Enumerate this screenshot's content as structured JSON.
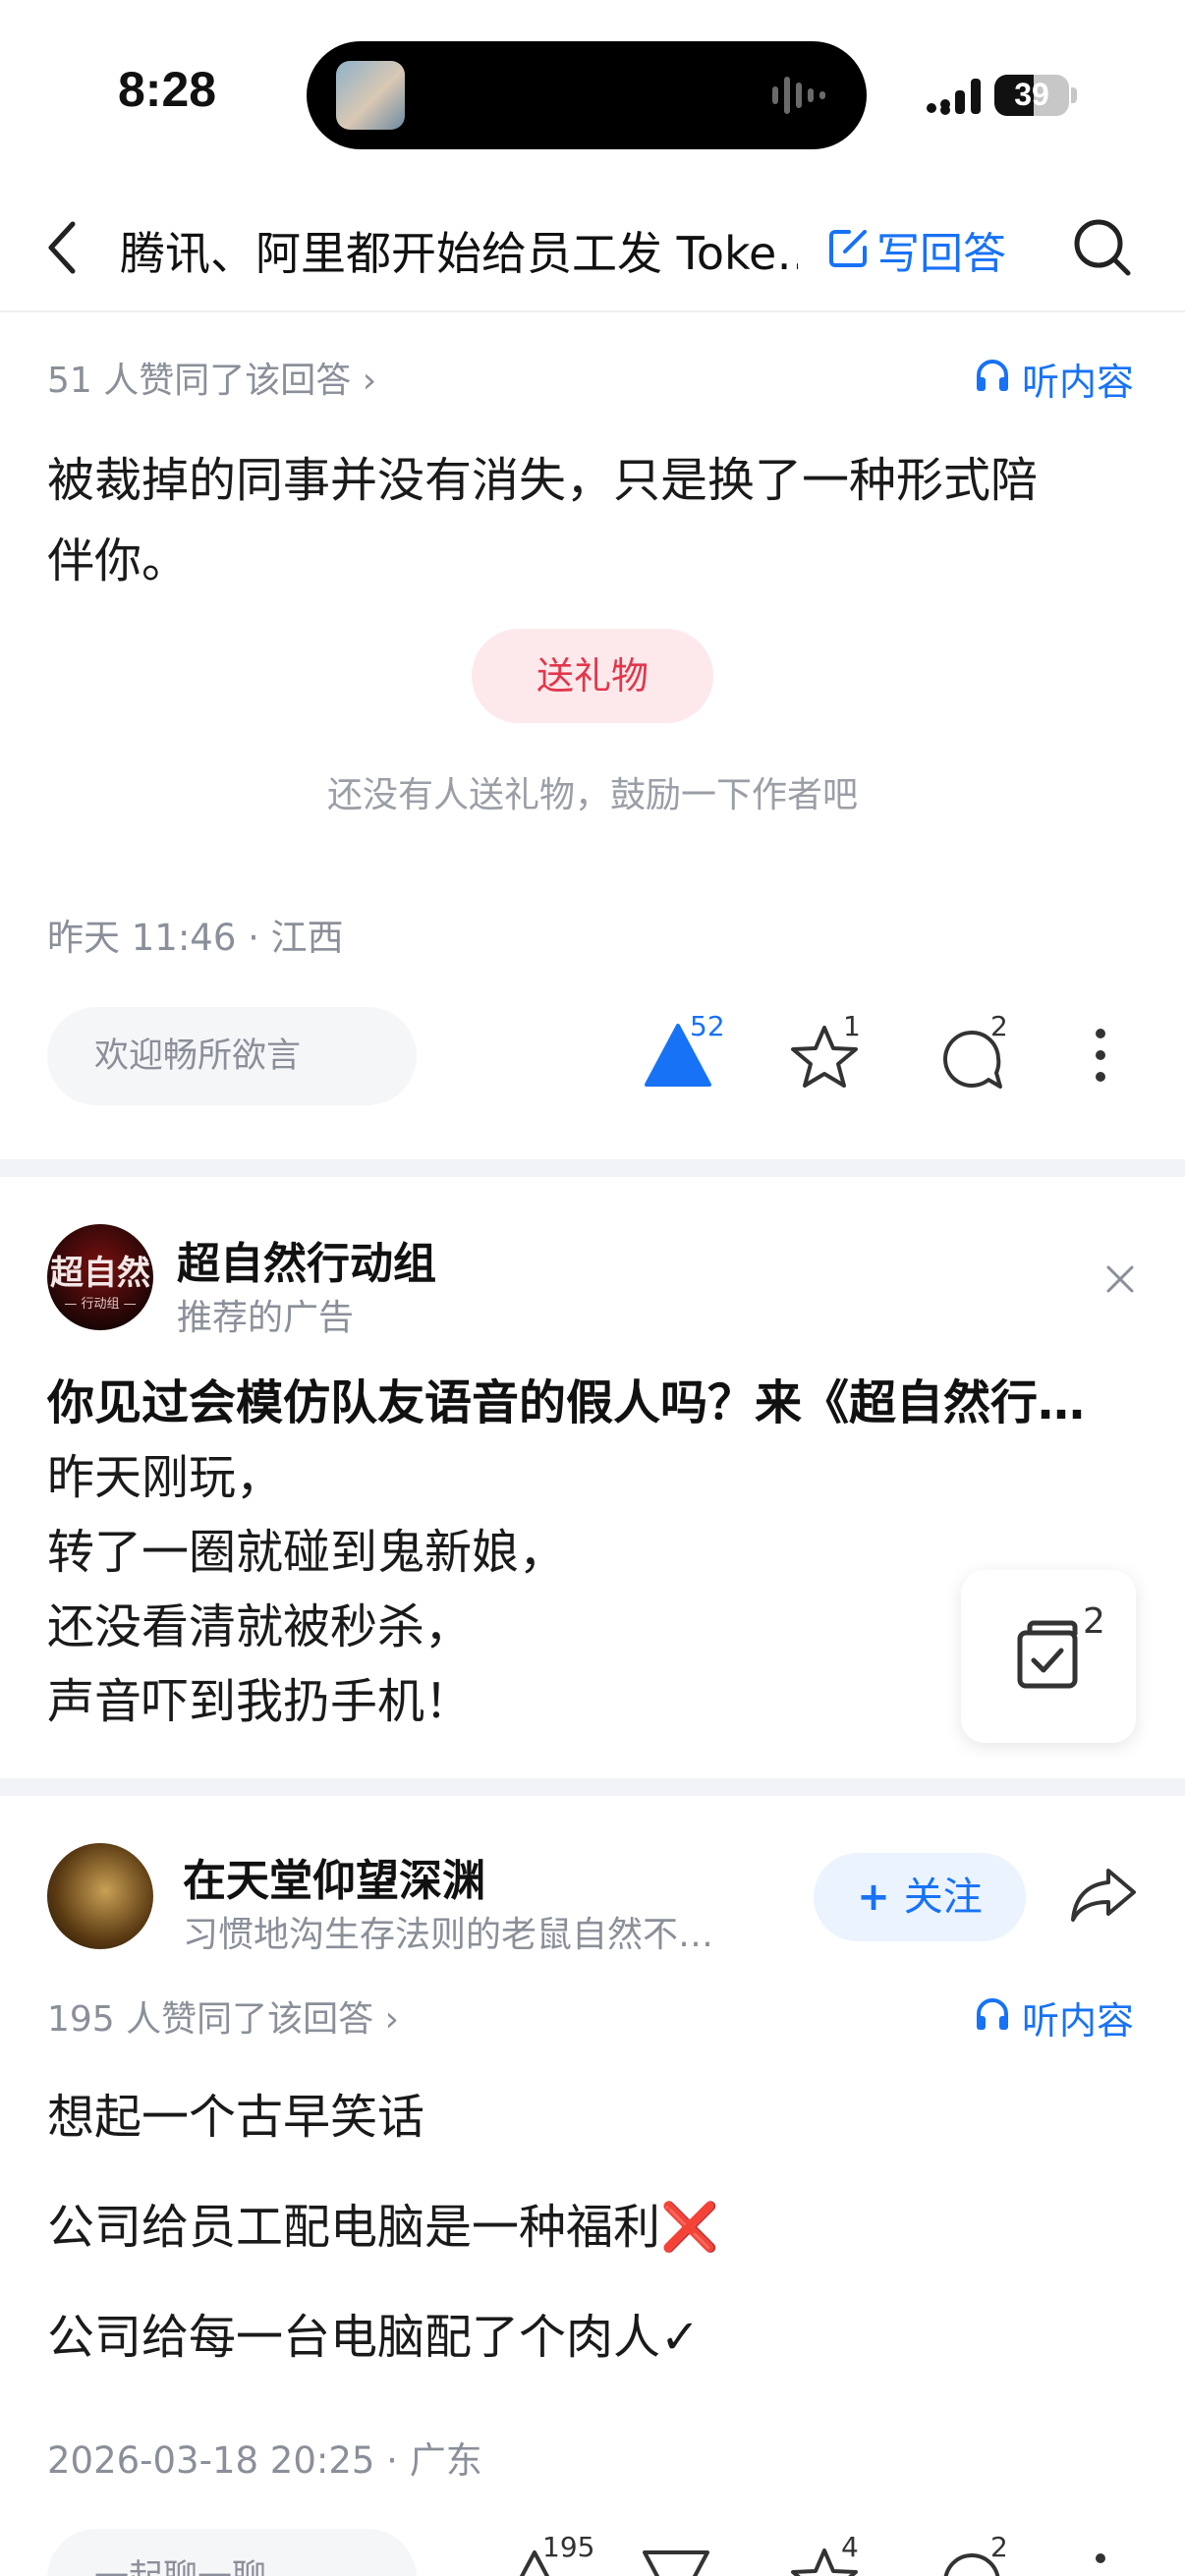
{
  "status_bar": {
    "time": "8:28",
    "battery": "39"
  },
  "nav": {
    "title": "腾讯、阿里都开始给员工发 Toke…",
    "write_label": "写回答"
  },
  "answer1": {
    "likes_text": "51 人赞同了该回答 ›",
    "listen_label": "听内容",
    "lines": [
      "被裁掉的同事并没有消失，只是换了一种形式陪",
      "伴你。"
    ],
    "gift_label": "送礼物",
    "gift_hint": "还没有人送礼物，鼓励一下作者吧",
    "meta": "昨天 11:46 · 江西",
    "comment_placeholder": "欢迎畅所欲言",
    "upvotes": "52",
    "favorites": "1",
    "comments": "2"
  },
  "ad": {
    "avatar_text": "超自然",
    "avatar_sub": "— 行动组 —",
    "name": "超自然行动组",
    "label": "推荐的广告",
    "title": "你见过会模仿队友语音的假人吗？来《超自然行…",
    "lines": [
      "昨天刚玩，",
      "转了一圈就碰到鬼新娘，",
      "还没看清就被秒杀，",
      "声音吓到我扔手机！"
    ]
  },
  "floating_card": {
    "badge": "2"
  },
  "answer2": {
    "author": "在天堂仰望深渊",
    "bio": "习惯地沟生存法则的老鼠自然不…",
    "follow_label": "关注",
    "likes_text": "195 人赞同了该回答 ›",
    "listen_label": "听内容",
    "lines": [
      "想起一个古早笑话",
      "公司给员工配电脑是一种福利❌",
      "公司给每一台电脑配了个肉人✓"
    ],
    "meta": "2026-03-18 20:25 · 广东",
    "comment_placeholder": "一起聊一聊",
    "upvotes": "195",
    "favorites": "4",
    "comments": "2"
  },
  "colors": {
    "accent": "#1772f6",
    "gift": "#e3364a",
    "cross": "#e8202a"
  }
}
